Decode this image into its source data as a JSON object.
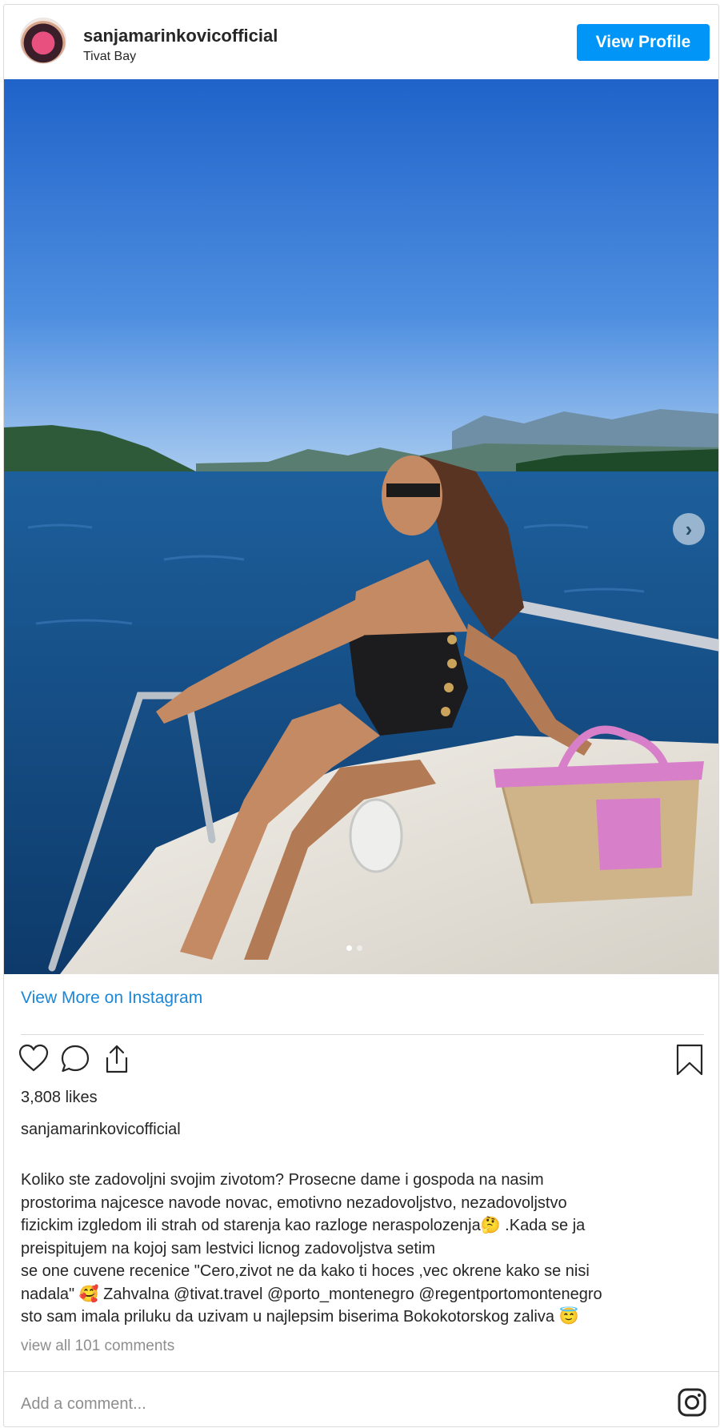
{
  "header": {
    "username": "sanjamarinkovicofficial",
    "location": "Tivat Bay",
    "view_profile_label": "View Profile"
  },
  "photo": {
    "next_icon": "chevron-right-icon",
    "carousel_dots": 2,
    "active_dot": 1
  },
  "view_more_label": "View More on Instagram",
  "actions": {
    "like_icon": "heart-icon",
    "comment_icon": "comment-icon",
    "share_icon": "share-icon",
    "save_icon": "bookmark-icon"
  },
  "likes": "3,808 likes",
  "caption_username": "sanjamarinkovicofficial",
  "caption_lines": [
    "Koliko ste zadovoljni svojim zivotom? Prosecne dame i gospoda na nasim",
    "prostorima najcesce navode novac, emotivno nezadovoljstvo, nezadovoljstvo",
    "fizickim izgledom ili strah od starenja kao razloge neraspolozenja🤔 .Kada se ja",
    "preispitujem na kojoj sam lestvici licnog zadovoljstva setim",
    "se one cuvene recenice \"Cero,zivot ne da kako ti hoces ,vec okrene kako se nisi",
    "nadala\" 🥰 Zahvalna @tivat.travel @porto_montenegro @regentportomontenegro",
    "sto sam imala priluku da uzivam u najlepsim biserima Bokokotorskog zaliva 😇"
  ],
  "comments_link": "view all 101 comments",
  "add_comment_placeholder": "Add a comment...",
  "instagram_icon": "instagram-icon",
  "colors": {
    "primary_button": "#0095f6",
    "link": "#1b87d6",
    "muted_text": "#8e8e8e",
    "border": "#dbdbdb"
  }
}
